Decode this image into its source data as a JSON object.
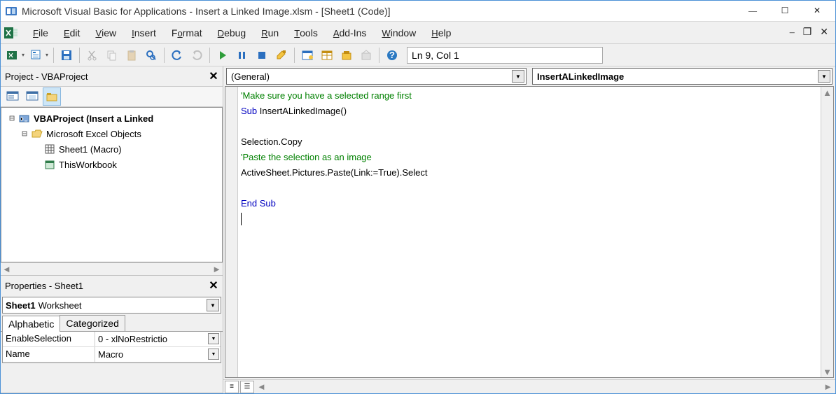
{
  "titlebar": {
    "title": "Microsoft Visual Basic for Applications - Insert a Linked Image.xlsm - [Sheet1 (Code)]"
  },
  "menu": {
    "file": "File",
    "edit": "Edit",
    "view": "View",
    "insert": "Insert",
    "format": "Format",
    "debug": "Debug",
    "run": "Run",
    "tools": "Tools",
    "addins": "Add-Ins",
    "window": "Window",
    "help": "Help"
  },
  "status": {
    "cursor": "Ln 9, Col 1"
  },
  "project_panel": {
    "title": "Project - VBAProject",
    "tree": {
      "root": "VBAProject (Insert a Linked",
      "folder": "Microsoft Excel Objects",
      "sheet": "Sheet1 (Macro)",
      "wb": "ThisWorkbook"
    }
  },
  "properties_panel": {
    "title": "Properties - Sheet1",
    "combo_object": "Sheet1",
    "combo_type": "Worksheet",
    "tabs": {
      "alpha": "Alphabetic",
      "cat": "Categorized"
    },
    "rows": [
      {
        "key": "EnableSelection",
        "value": "0 - xlNoRestrictio"
      },
      {
        "key": "Name",
        "value": "Macro"
      }
    ]
  },
  "code_header": {
    "left": "(General)",
    "right": "InsertALinkedImage"
  },
  "code": {
    "l1_comment": "'Make sure you have a selected range first",
    "l2_kw": "Sub",
    "l2_rest": " InsertALinkedImage()",
    "l3": "",
    "l4": "Selection.Copy",
    "l5_comment": "'Paste the selection as an image",
    "l6": "ActiveSheet.Pictures.Paste(Link:=True).Select",
    "l7": "",
    "l8a": "End ",
    "l8b": "Sub"
  }
}
